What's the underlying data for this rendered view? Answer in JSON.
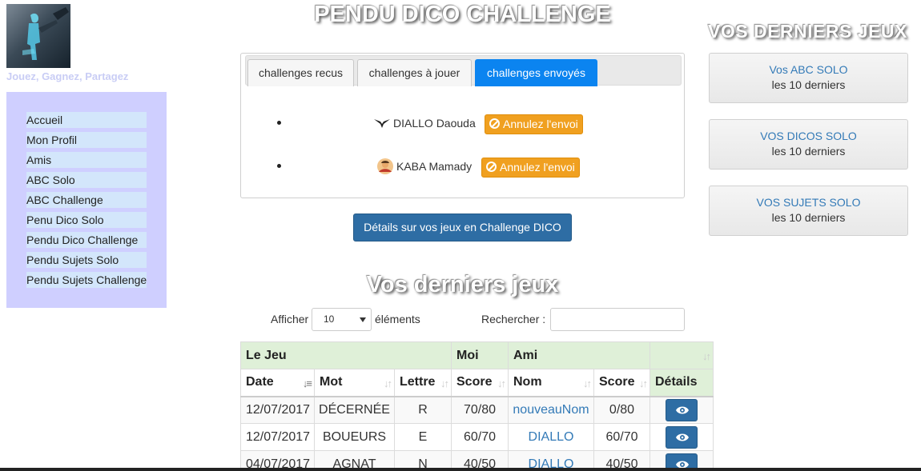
{
  "app": {
    "title": "PENDU DICO CHALLENGE",
    "tagline": "Jouez, Gagnez, Partagez"
  },
  "sidebar": {
    "items": [
      {
        "label": "Accueil"
      },
      {
        "label": "Mon Profil"
      },
      {
        "label": "Amis"
      },
      {
        "label": "ABC Solo"
      },
      {
        "label": "ABC Challenge"
      },
      {
        "label": "Penu Dico Solo"
      },
      {
        "label": "Pendu Dico Challenge"
      },
      {
        "label": "Pendu Sujets Solo"
      },
      {
        "label": "Pendu Sujets Challenge"
      }
    ]
  },
  "tabs": [
    {
      "label": "challenges recus",
      "active": false
    },
    {
      "label": "challenges à jouer",
      "active": false
    },
    {
      "label": "challenges envoyés",
      "active": true
    }
  ],
  "challenges": [
    {
      "name": "DIALLO Daouda",
      "icon": "bird-icon",
      "action": "Annulez l'envoi"
    },
    {
      "name": "KABA Mamady",
      "icon": "user-avatar-icon",
      "action": "Annulez l'envoi"
    }
  ],
  "details_button": "Détails sur vos jeux en Challenge DICO",
  "games_section": {
    "title": "Vos derniers jeux",
    "show_label": "Afficher",
    "show_value": "10",
    "elements_label": "éléments",
    "search_label": "Rechercher :",
    "search_value": ""
  },
  "table": {
    "group_headers": {
      "game": "Le Jeu",
      "me": "Moi",
      "friend": "Ami"
    },
    "headers": {
      "date": "Date",
      "word": "Mot",
      "letter": "Lettre",
      "score_me": "Score",
      "name": "Nom",
      "score_friend": "Score",
      "details": "Détails"
    },
    "rows": [
      {
        "date": "12/07/2017",
        "word": "DÉCERNÉE",
        "letter": "R",
        "score_me": "70/80",
        "name": "nouveauNom",
        "score_friend": "0/80"
      },
      {
        "date": "12/07/2017",
        "word": "BOUEURS",
        "letter": "E",
        "score_me": "60/70",
        "name": "DIALLO",
        "score_friend": "60/70"
      },
      {
        "date": "04/07/2017",
        "word": "AGNAT",
        "letter": "N",
        "score_me": "40/50",
        "name": "DIALLO",
        "score_friend": "40/50"
      }
    ]
  },
  "right_panel": {
    "title": "VOS DERNIERS JEUX",
    "cards": [
      {
        "title": "Vos ABC SOLO",
        "subtitle": "les 10 derniers"
      },
      {
        "title": "VOS DICOS SOLO",
        "subtitle": "les 10 derniers"
      },
      {
        "title": "VOS SUJETS SOLO",
        "subtitle": "les 10 derniers"
      }
    ]
  },
  "colors": {
    "active_tab": "#0b84f0",
    "primary_button": "#2e6da4",
    "warning_button": "#f0a020",
    "sidebar_bg": "#cfcfff",
    "table_group_bg": "#dff0d8"
  }
}
